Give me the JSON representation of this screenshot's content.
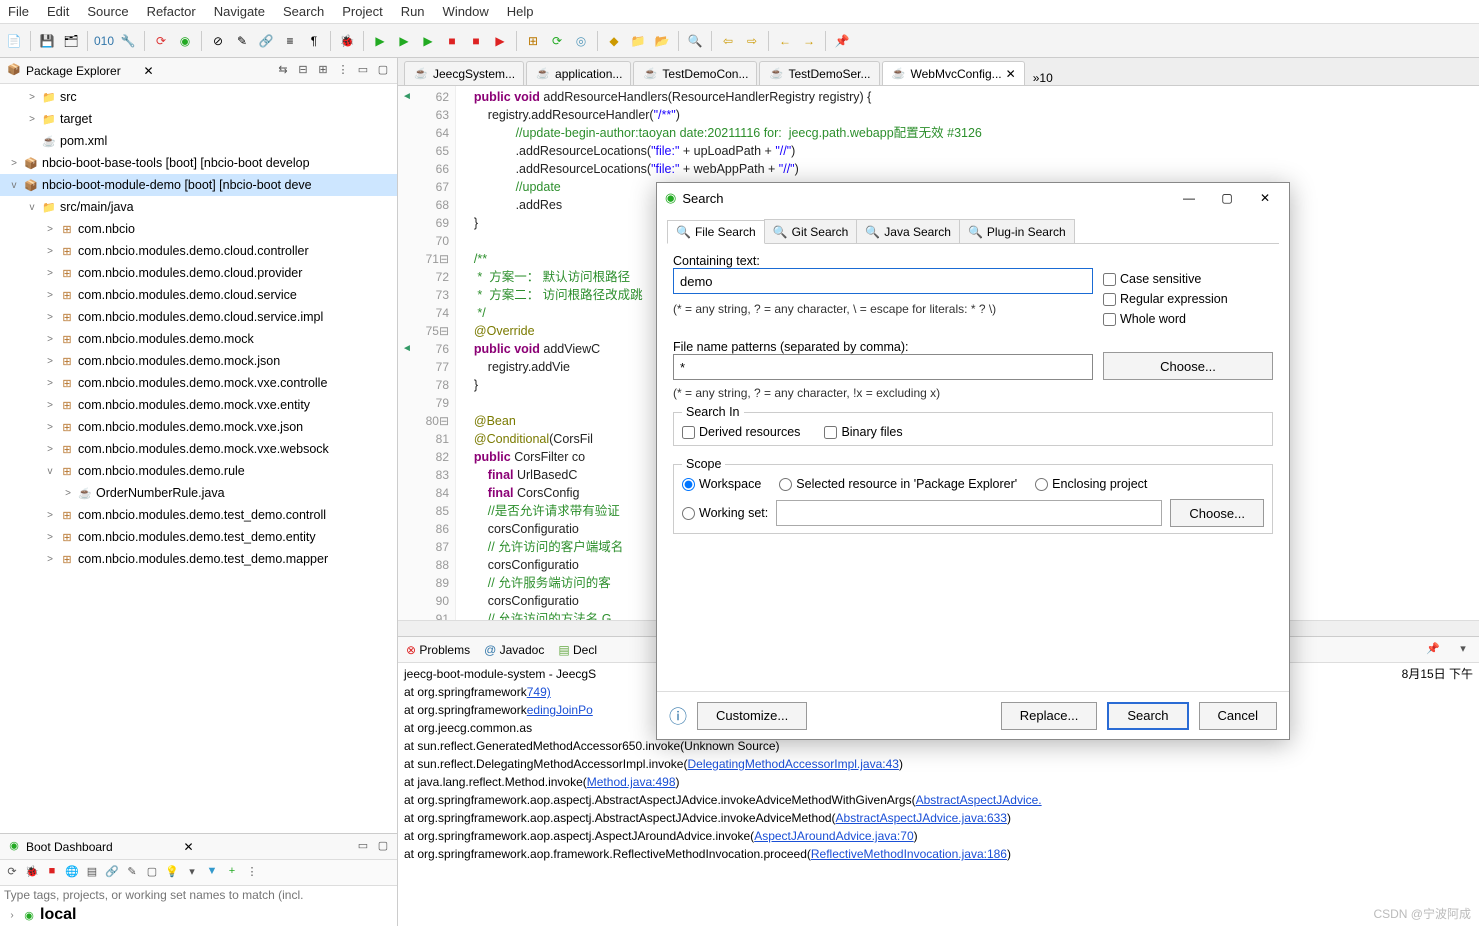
{
  "menu": [
    "File",
    "Edit",
    "Source",
    "Refactor",
    "Navigate",
    "Search",
    "Project",
    "Run",
    "Window",
    "Help"
  ],
  "pkg_explorer": {
    "title": "Package Explorer",
    "nodes": [
      {
        "depth": 1,
        "twist": ">",
        "icon": "fld",
        "label": "src"
      },
      {
        "depth": 1,
        "twist": ">",
        "icon": "fld",
        "label": "target"
      },
      {
        "depth": 1,
        "twist": "",
        "icon": "jf",
        "label": "pom.xml"
      },
      {
        "depth": 0,
        "twist": ">",
        "icon": "proj",
        "label": "nbcio-boot-base-tools [boot] [nbcio-boot develop"
      },
      {
        "depth": 0,
        "twist": "v",
        "icon": "proj",
        "label": "nbcio-boot-module-demo [boot] [nbcio-boot deve",
        "sel": true
      },
      {
        "depth": 1,
        "twist": "v",
        "icon": "fld",
        "label": "src/main/java"
      },
      {
        "depth": 2,
        "twist": ">",
        "icon": "pkg",
        "label": "com.nbcio"
      },
      {
        "depth": 2,
        "twist": ">",
        "icon": "pkg",
        "label": "com.nbcio.modules.demo.cloud.controller"
      },
      {
        "depth": 2,
        "twist": ">",
        "icon": "pkg",
        "label": "com.nbcio.modules.demo.cloud.provider"
      },
      {
        "depth": 2,
        "twist": ">",
        "icon": "pkg",
        "label": "com.nbcio.modules.demo.cloud.service"
      },
      {
        "depth": 2,
        "twist": ">",
        "icon": "pkg",
        "label": "com.nbcio.modules.demo.cloud.service.impl"
      },
      {
        "depth": 2,
        "twist": ">",
        "icon": "pkg",
        "label": "com.nbcio.modules.demo.mock"
      },
      {
        "depth": 2,
        "twist": ">",
        "icon": "pkg",
        "label": "com.nbcio.modules.demo.mock.json"
      },
      {
        "depth": 2,
        "twist": ">",
        "icon": "pkg",
        "label": "com.nbcio.modules.demo.mock.vxe.controlle"
      },
      {
        "depth": 2,
        "twist": ">",
        "icon": "pkg",
        "label": "com.nbcio.modules.demo.mock.vxe.entity"
      },
      {
        "depth": 2,
        "twist": ">",
        "icon": "pkg",
        "label": "com.nbcio.modules.demo.mock.vxe.json"
      },
      {
        "depth": 2,
        "twist": ">",
        "icon": "pkg",
        "label": "com.nbcio.modules.demo.mock.vxe.websock"
      },
      {
        "depth": 2,
        "twist": "v",
        "icon": "pkg",
        "label": "com.nbcio.modules.demo.rule"
      },
      {
        "depth": 3,
        "twist": ">",
        "icon": "jf",
        "label": "OrderNumberRule.java"
      },
      {
        "depth": 2,
        "twist": ">",
        "icon": "pkg",
        "label": "com.nbcio.modules.demo.test_demo.controll"
      },
      {
        "depth": 2,
        "twist": ">",
        "icon": "pkg",
        "label": "com.nbcio.modules.demo.test_demo.entity"
      },
      {
        "depth": 2,
        "twist": ">",
        "icon": "pkg",
        "label": "com.nbcio.modules.demo.test_demo.mapper"
      }
    ]
  },
  "boot_dash": {
    "title": "Boot Dashboard",
    "placeholder": "Type tags, projects, or working set names to match (incl.",
    "local": "local"
  },
  "editor_tabs": [
    {
      "label": "JeecgSystem...",
      "icon": "jf"
    },
    {
      "label": "application...",
      "icon": "jf"
    },
    {
      "label": "TestDemoCon...",
      "icon": "jf"
    },
    {
      "label": "TestDemoSer...",
      "icon": "jf"
    },
    {
      "label": "WebMvcConfig...",
      "icon": "jf",
      "active": true,
      "close": true
    }
  ],
  "editor_overflow": "»10",
  "code_lines": [
    {
      "n": 62,
      "mk": "◄",
      "html": "    <span class='kw'>public</span> <span class='kw'>void</span> addResourceHandlers(ResourceHandlerRegistry registry) {"
    },
    {
      "n": 63,
      "html": "        registry.addResourceHandler(<span class='str'>\"/**\"</span>)"
    },
    {
      "n": 64,
      "html": "                <span class='cm'>//update-begin-author:taoyan date:20211116 for:  jeecg.path.webapp配置无效 #3126</span>"
    },
    {
      "n": 65,
      "html": "                .addResourceLocations(<span class='str'>\"file:\"</span> + upLoadPath + <span class='str'>\"//\"</span>)"
    },
    {
      "n": 66,
      "html": "                .addResourceLocations(<span class='str'>\"file:\"</span> + webAppPath + <span class='str'>\"//\"</span>)"
    },
    {
      "n": 67,
      "html": "                <span class='cm'>//update</span>"
    },
    {
      "n": 68,
      "html": "                .addRes"
    },
    {
      "n": 69,
      "html": "    }"
    },
    {
      "n": 70,
      "html": ""
    },
    {
      "n": 71,
      "fold": true,
      "html": "    <span class='cm'>/**</span>"
    },
    {
      "n": 72,
      "html": "    <span class='cm'> *  方案一： 默认访问根路径</span>"
    },
    {
      "n": 73,
      "html": "    <span class='cm'> *  方案二： 访问根路径改成跳</span>"
    },
    {
      "n": 74,
      "html": "    <span class='cm'> */</span>"
    },
    {
      "n": 75,
      "fold": true,
      "html": "    <span class='ann'>@Override</span>"
    },
    {
      "n": 76,
      "mk": "◄",
      "html": "    <span class='kw'>public</span> <span class='kw'>void</span> addViewC"
    },
    {
      "n": 77,
      "html": "        registry.addVie"
    },
    {
      "n": 78,
      "html": "    }"
    },
    {
      "n": 79,
      "html": ""
    },
    {
      "n": 80,
      "fold": true,
      "html": "    <span class='ann'>@Bean</span>"
    },
    {
      "n": 81,
      "html": "    <span class='ann'>@Conditional</span>(CorsFil"
    },
    {
      "n": 82,
      "html": "    <span class='kw'>public</span> CorsFilter co"
    },
    {
      "n": 83,
      "html": "        <span class='kw'>final</span> UrlBasedC                                                                                                                                   urationSour"
    },
    {
      "n": 84,
      "html": "        <span class='kw'>final</span> CorsConfig"
    },
    {
      "n": 85,
      "html": "        <span class='cm'>//是否允许请求带有验证</span>"
    },
    {
      "n": 86,
      "html": "        corsConfiguratio"
    },
    {
      "n": 87,
      "html": "        <span class='cm'>// 允许访问的客户端域名</span>"
    },
    {
      "n": 88,
      "html": "        corsConfiguratio"
    },
    {
      "n": 89,
      "html": "        <span class='cm'>// 允许服务端访问的客</span>"
    },
    {
      "n": 90,
      "html": "        corsConfiguratio"
    },
    {
      "n": 91,
      "html": "        <span class='cm'>// 允许访问的方法名,G</span>"
    }
  ],
  "bottom_tabs": {
    "problems": "Problems",
    "javadoc": "Javadoc",
    "decl": "Decl"
  },
  "console": {
    "header": "jeecg-boot-module-system - JeecgS",
    "date_frag": "8月15日 下午",
    "lines": [
      {
        "pre": "    at org.springframework",
        "link": "749)"
      },
      {
        "pre": "    at org.springframework",
        "link": "edingJoinPo"
      },
      {
        "pre": "    at org.jeecg.common.as"
      },
      {
        "pre": "    at sun.reflect.GeneratedMethodAccessor650.invoke(Unknown Source)"
      },
      {
        "pre": "    at sun.reflect.DelegatingMethodAccessorImpl.invoke(",
        "link": "DelegatingMethodAccessorImpl.java:43",
        "post": ")"
      },
      {
        "pre": "    at java.lang.reflect.Method.invoke(",
        "link": "Method.java:498",
        "post": ")"
      },
      {
        "pre": "    at org.springframework.aop.aspectj.AbstractAspectJAdvice.invokeAdviceMethodWithGivenArgs(",
        "link": "AbstractAspectJAdvice.",
        "post": ""
      },
      {
        "pre": "    at org.springframework.aop.aspectj.AbstractAspectJAdvice.invokeAdviceMethod(",
        "link": "AbstractAspectJAdvice.java:633",
        "post": ")"
      },
      {
        "pre": "    at org.springframework.aop.aspectj.AspectJAroundAdvice.invoke(",
        "link": "AspectJAroundAdvice.java:70",
        "post": ")"
      },
      {
        "pre": "    at org.springframework.aop.framework.ReflectiveMethodInvocation.proceed(",
        "link": "ReflectiveMethodInvocation.java:186",
        "post": ")"
      }
    ]
  },
  "search": {
    "title": "Search",
    "tabs": [
      "File Search",
      "Git Search",
      "Java Search",
      "Plug-in Search"
    ],
    "containing_label": "Containing text:",
    "containing_value": "demo",
    "hint1": "(* = any string, ? = any character, \\ = escape for literals: * ? \\)",
    "pattern_label": "File name patterns (separated by comma):",
    "pattern_value": "*",
    "choose": "Choose...",
    "hint2": "(* = any string, ? = any character, !x = excluding x)",
    "case": "Case sensitive",
    "regex": "Regular expression",
    "whole": "Whole word",
    "searchin": "Search In",
    "derived": "Derived resources",
    "binary": "Binary files",
    "scope": "Scope",
    "workspace": "Workspace",
    "selected": "Selected resource in 'Package Explorer'",
    "enclosing": "Enclosing project",
    "working": "Working set:",
    "customize": "Customize...",
    "replace": "Replace...",
    "search_btn": "Search",
    "cancel": "Cancel"
  },
  "watermark": "CSDN @宁波阿成"
}
